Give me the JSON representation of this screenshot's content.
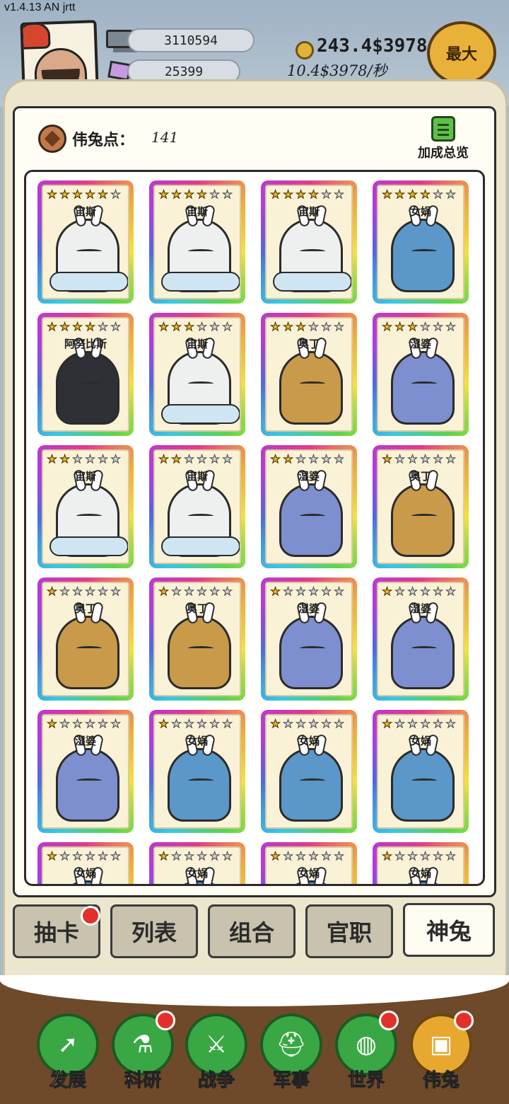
{
  "version": "v1.4.13 AN jrtt",
  "resources": {
    "silver": "3110594",
    "gems": "25399"
  },
  "gold": {
    "amount": "243.4$3978",
    "rate": "10.4$3978/秒"
  },
  "max_button": "最大",
  "god_points": {
    "label": "伟兔点：",
    "value": "141"
  },
  "bonus_overview": "加成总览",
  "cards": [
    {
      "name": "宙斯",
      "stars": 5,
      "type": "white"
    },
    {
      "name": "宙斯",
      "stars": 4,
      "type": "white"
    },
    {
      "name": "宙斯",
      "stars": 4,
      "type": "white"
    },
    {
      "name": "女娲",
      "stars": 4,
      "type": "robe"
    },
    {
      "name": "阿努比斯",
      "stars": 4,
      "type": "black"
    },
    {
      "name": "宙斯",
      "stars": 3,
      "type": "white"
    },
    {
      "name": "奥丁",
      "stars": 3,
      "type": "gold"
    },
    {
      "name": "湿婆",
      "stars": 3,
      "type": "blue"
    },
    {
      "name": "宙斯",
      "stars": 2,
      "type": "white"
    },
    {
      "name": "宙斯",
      "stars": 2,
      "type": "white"
    },
    {
      "name": "湿婆",
      "stars": 2,
      "type": "blue"
    },
    {
      "name": "奥丁",
      "stars": 1,
      "type": "gold"
    },
    {
      "name": "奥丁",
      "stars": 1,
      "type": "gold"
    },
    {
      "name": "奥丁",
      "stars": 1,
      "type": "gold"
    },
    {
      "name": "湿婆",
      "stars": 1,
      "type": "blue"
    },
    {
      "name": "湿婆",
      "stars": 1,
      "type": "blue"
    },
    {
      "name": "湿婆",
      "stars": 1,
      "type": "blue"
    },
    {
      "name": "女娲",
      "stars": 1,
      "type": "robe"
    },
    {
      "name": "女娲",
      "stars": 1,
      "type": "robe"
    },
    {
      "name": "女娲",
      "stars": 1,
      "type": "robe"
    },
    {
      "name": "女娲",
      "stars": 1,
      "type": "robe"
    },
    {
      "name": "女娲",
      "stars": 1,
      "type": "robe"
    },
    {
      "name": "女娲",
      "stars": 1,
      "type": "robe"
    },
    {
      "name": "女娲",
      "stars": 1,
      "type": "robe"
    }
  ],
  "max_stars": 6,
  "tabs": {
    "draw": "抽卡",
    "list": "列表",
    "combo": "组合",
    "office": "官职",
    "god": "神兔"
  },
  "nav": {
    "develop": "发展",
    "research": "科研",
    "war": "战争",
    "military": "军事",
    "world": "世界",
    "godrabbit": "伟兔"
  },
  "icons": {
    "develop": "arrow-icon",
    "research": "flask-icon",
    "war": "swords-icon",
    "military": "helmet-icon",
    "world": "globe-icon",
    "godrabbit": "rabbit-card-icon"
  }
}
